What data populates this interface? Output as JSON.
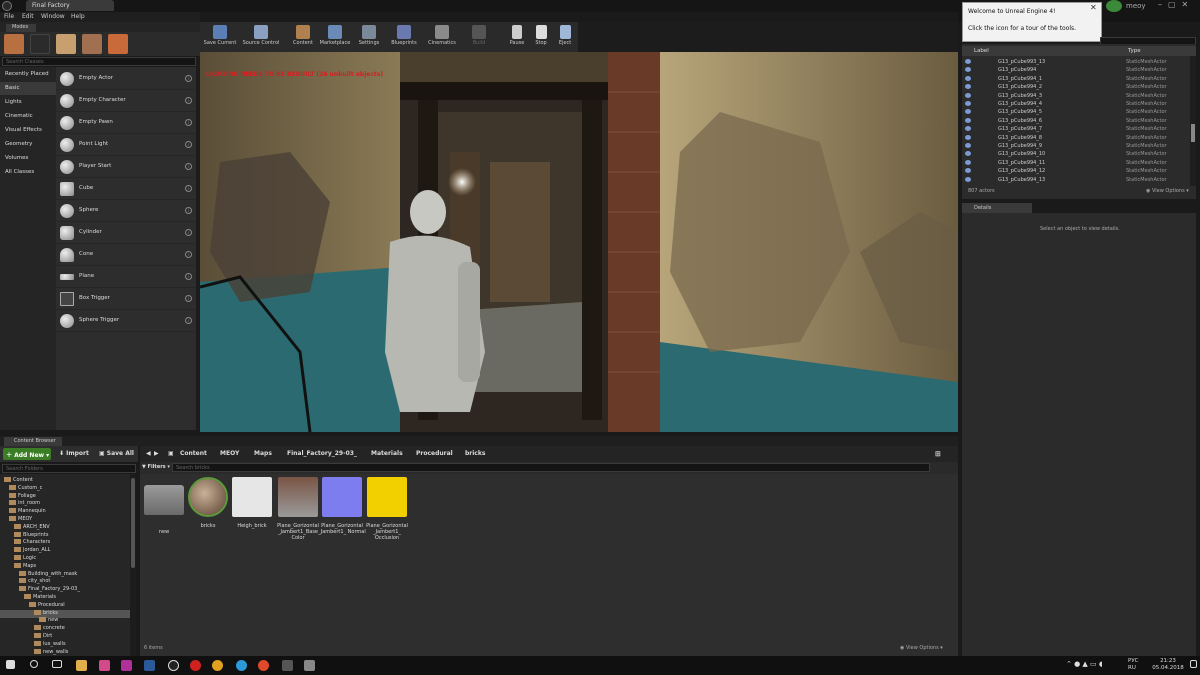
{
  "window": {
    "tab_title": "Final Factory",
    "user": "meoy"
  },
  "menu": [
    "File",
    "Edit",
    "Window",
    "Help"
  ],
  "modes": {
    "tab_label": "Modes",
    "search_placeholder": "Search Classes"
  },
  "categories": [
    "Recently Placed",
    "Basic",
    "Lights",
    "Cinematic",
    "Visual Effects",
    "Geometry",
    "Volumes",
    "All Classes"
  ],
  "placeables": [
    "Empty Actor",
    "Empty Character",
    "Empty Pawn",
    "Point Light",
    "Player Start",
    "Cube",
    "Sphere",
    "Cylinder",
    "Cone",
    "Plane",
    "Box Trigger",
    "Sphere Trigger"
  ],
  "toolbar": [
    "Save Current",
    "Source Control",
    "Content",
    "Marketplace",
    "Settings",
    "Blueprints",
    "Cinematics",
    "Build",
    "Pause",
    "Stop",
    "Eject"
  ],
  "viewport": {
    "warning": "LIGHTING NEEDS TO BE REBUILT (26 unbuilt objects)"
  },
  "content_browser": {
    "tab_label": "Content Browser",
    "add_new": "Add New",
    "import": "Import",
    "save_all": "Save All",
    "search_folders": "Search Folders",
    "filters": "Filters",
    "search_assets": "Search bricks",
    "breadcrumb": [
      "Content",
      "MEOY",
      "Maps",
      "Final_Factory_29-03_",
      "Materials",
      "Procedural",
      "bricks"
    ],
    "tree": [
      {
        "label": "Content",
        "depth": 0
      },
      {
        "label": "Custom_c",
        "depth": 1
      },
      {
        "label": "Foliage",
        "depth": 1
      },
      {
        "label": "int_room",
        "depth": 1
      },
      {
        "label": "Mannequin",
        "depth": 1
      },
      {
        "label": "MEOY",
        "depth": 1
      },
      {
        "label": "ARCH_ENV",
        "depth": 2
      },
      {
        "label": "Blueprints",
        "depth": 2
      },
      {
        "label": "Characters",
        "depth": 2
      },
      {
        "label": "Jordan_ALL",
        "depth": 2
      },
      {
        "label": "Logic",
        "depth": 2
      },
      {
        "label": "Maps",
        "depth": 2
      },
      {
        "label": "Building_with_mask",
        "depth": 3
      },
      {
        "label": "city_shot",
        "depth": 3
      },
      {
        "label": "Final_Factory_29-03_",
        "depth": 3
      },
      {
        "label": "Materials",
        "depth": 4
      },
      {
        "label": "Procedural",
        "depth": 5
      },
      {
        "label": "bricks",
        "depth": 6
      },
      {
        "label": "new",
        "depth": 7
      },
      {
        "label": "concrete",
        "depth": 6
      },
      {
        "label": "Dirt",
        "depth": 6
      },
      {
        "label": "lux_walls",
        "depth": 6
      },
      {
        "label": "new_walls",
        "depth": 6
      }
    ],
    "assets": [
      {
        "label": "new",
        "color": "#9a9a9a"
      },
      {
        "label": "bricks",
        "color": "#8a6a55"
      },
      {
        "label": "Heigh_brick",
        "color": "#e6e6e6"
      },
      {
        "label": "Plane_Gorizontal _Jambert1_Base Color",
        "color": "#7a5545"
      },
      {
        "label": "Plane_Gorizontal _Jambert1_ Normal",
        "color": "#7d7df0"
      },
      {
        "label": "Plane_Gorizontal _Jambert1_ Occlusion",
        "color": "#f2d000"
      }
    ],
    "items_count": "6 items",
    "view_options": "View Options"
  },
  "welcome": {
    "title": "Welcome to Unreal Engine 4!",
    "body": "Click the  icon for a tour of the tools."
  },
  "outliner": {
    "col_label": "Label",
    "col_type": "Type",
    "rows": [
      {
        "name": "G13_pCube993_13",
        "type": "StaticMeshActor"
      },
      {
        "name": "G13_pCube994",
        "type": "StaticMeshActor"
      },
      {
        "name": "G13_pCube994_1",
        "type": "StaticMeshActor"
      },
      {
        "name": "G13_pCube994_2",
        "type": "StaticMeshActor"
      },
      {
        "name": "G13_pCube994_3",
        "type": "StaticMeshActor"
      },
      {
        "name": "G13_pCube994_4",
        "type": "StaticMeshActor"
      },
      {
        "name": "G13_pCube994_5",
        "type": "StaticMeshActor"
      },
      {
        "name": "G13_pCube994_6",
        "type": "StaticMeshActor"
      },
      {
        "name": "G13_pCube994_7",
        "type": "StaticMeshActor"
      },
      {
        "name": "G13_pCube994_8",
        "type": "StaticMeshActor"
      },
      {
        "name": "G13_pCube994_9",
        "type": "StaticMeshActor"
      },
      {
        "name": "G13_pCube994_10",
        "type": "StaticMeshActor"
      },
      {
        "name": "G13_pCube994_11",
        "type": "StaticMeshActor"
      },
      {
        "name": "G13_pCube994_12",
        "type": "StaticMeshActor"
      },
      {
        "name": "G13_pCube994_13",
        "type": "StaticMeshActor"
      }
    ],
    "actors_count": "807 actors",
    "view_options": "View Options"
  },
  "details": {
    "tab_label": "Details",
    "empty_msg": "Select an object to view details."
  },
  "taskbar": {
    "lang1": "РУС",
    "lang2": "RU",
    "time": "21:23",
    "date": "05.04.2018"
  }
}
